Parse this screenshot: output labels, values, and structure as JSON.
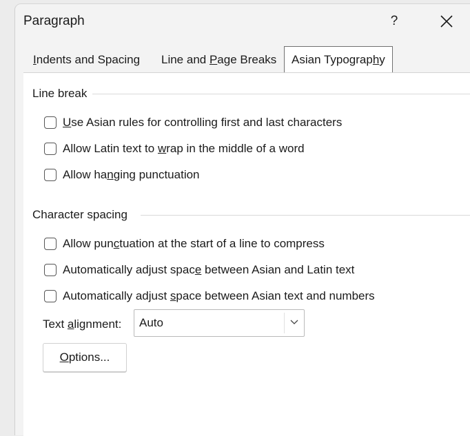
{
  "dialog": {
    "title": "Paragraph",
    "help_label": "?"
  },
  "tabs": [
    {
      "pre": "",
      "acc": "I",
      "post": "ndents and Spacing",
      "active": false
    },
    {
      "pre": "Line and ",
      "acc": "P",
      "post": "age Breaks",
      "active": false
    },
    {
      "pre": "Asian Typograp",
      "acc": "h",
      "post": "y",
      "active": true
    }
  ],
  "line_break": {
    "label": "Line break",
    "items": [
      {
        "pre": "",
        "acc": "U",
        "post": "se Asian rules for controlling first and last characters",
        "checked": false
      },
      {
        "pre": "Allow Latin text to ",
        "acc": "w",
        "post": "rap in the middle of a word",
        "checked": false
      },
      {
        "pre": "Allow ha",
        "acc": "n",
        "post": "ging punctuation",
        "checked": false
      }
    ]
  },
  "character_spacing": {
    "label": "Character spacing",
    "items": [
      {
        "pre": "Allow pun",
        "acc": "c",
        "post": "tuation at the start of a line to compress",
        "checked": false
      },
      {
        "pre": "Automatically adjust spac",
        "acc": "e",
        "post": " between Asian and Latin text",
        "checked": false
      },
      {
        "pre": "Automatically adjust ",
        "acc": "s",
        "post": "pace between Asian text and numbers",
        "checked": false
      }
    ]
  },
  "text_alignment": {
    "pre": "Text ",
    "acc": "a",
    "post": "lignment:",
    "value": "Auto"
  },
  "options_button": {
    "acc": "O",
    "post": "ptions..."
  }
}
